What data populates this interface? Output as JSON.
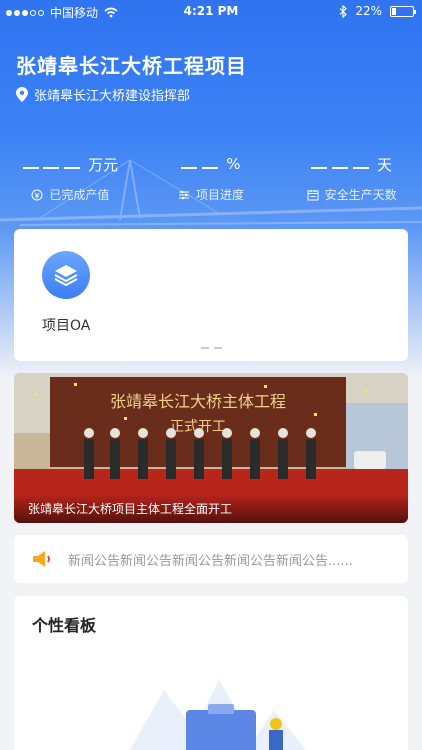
{
  "status_bar": {
    "carrier": "中国移动",
    "time": "4:21 PM",
    "battery_percent": "22%",
    "battery_level": 0.22
  },
  "header": {
    "title": "张靖皋长江大桥工程项目",
    "location": "张靖皋长江大桥建设指挥部"
  },
  "stats": [
    {
      "unit": "万元",
      "label": "已完成产值",
      "icon": "output-value-icon"
    },
    {
      "unit": "%",
      "label": "项目进度",
      "icon": "progress-icon"
    },
    {
      "unit": "天",
      "label": "安全生产天数",
      "icon": "calendar-icon"
    }
  ],
  "apps": [
    {
      "label": "项目OA",
      "icon": "layers-icon"
    }
  ],
  "banner": {
    "caption": "张靖皋长江大桥项目主体工程全面开工",
    "sign_text": "张靖皋长江大桥主体工程",
    "sign_sub": "正式开工"
  },
  "news": {
    "text": "新闻公告新闻公告新闻公告新闻公告新闻公告......"
  },
  "board": {
    "title": "个性看板"
  },
  "colors": {
    "primary": "#2f73f0",
    "background": "#f2f3f7"
  }
}
